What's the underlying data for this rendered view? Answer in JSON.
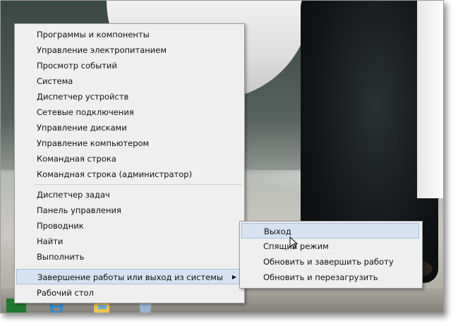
{
  "menu": {
    "items": [
      {
        "label": "Программы и компоненты"
      },
      {
        "label": "Управление электропитанием"
      },
      {
        "label": "Просмотр событий"
      },
      {
        "label": "Система"
      },
      {
        "label": "Диспетчер устройств"
      },
      {
        "label": "Сетевые подключения"
      },
      {
        "label": "Управление дисками"
      },
      {
        "label": "Управление компьютером"
      },
      {
        "label": "Командная строка"
      },
      {
        "label": "Командная строка (администратор)"
      },
      {
        "label": "Диспетчер задач"
      },
      {
        "label": "Панель управления"
      },
      {
        "label": "Проводник"
      },
      {
        "label": "Найти"
      },
      {
        "label": "Выполнить"
      },
      {
        "label": "Завершение работы или выход из системы",
        "active": true,
        "submenu_arrow": "chevron-right-icon"
      },
      {
        "label": "Рабочий стол"
      }
    ]
  },
  "submenu": {
    "items": [
      {
        "label": "Выход",
        "hovered": true
      },
      {
        "label": "Спящий режим"
      },
      {
        "label": "Обновить и завершить работу"
      },
      {
        "label": "Обновить и перезагрузить"
      }
    ]
  },
  "colors": {
    "menu_bg": "#efefef",
    "highlight_bg": "#d6e2f2",
    "highlight_border": "#a7bfdc",
    "start_tile": "#1e7a2e"
  },
  "icons": [
    "start-icon",
    "ie-icon",
    "explorer-icon",
    "store-icon",
    "mouse-cursor-icon"
  ]
}
